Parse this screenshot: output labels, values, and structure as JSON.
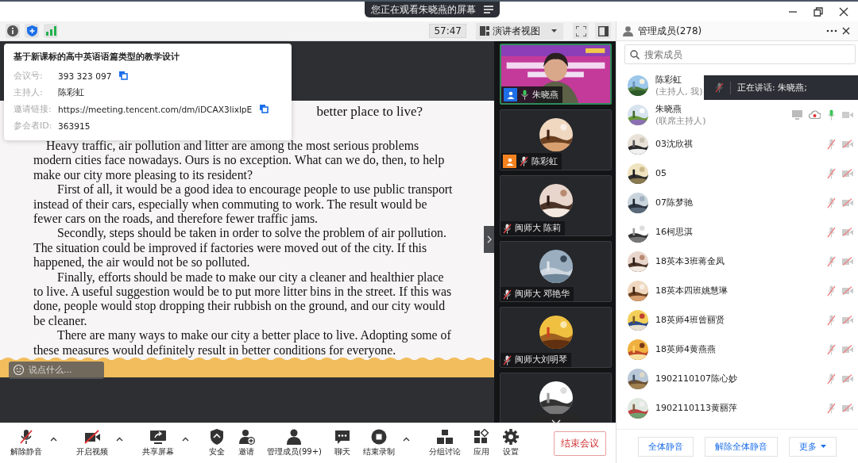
{
  "titlebar": {
    "banner": "您正在观看朱晓燕的屏幕"
  },
  "toolbar": {
    "timer": "57:47",
    "view": "演讲者视图"
  },
  "info_popup": {
    "title": "基于新课标的高中英语语篇类型的教学设计",
    "rows": [
      {
        "label": "会议号:",
        "value": "393 323 097",
        "copyable": true
      },
      {
        "label": "主持人:",
        "value": "陈彩虹",
        "copyable": false
      },
      {
        "label": "邀请链接:",
        "value": "https://meeting.tencent.com/dm/iDCAX3lixlpE",
        "copyable": true
      },
      {
        "label": "参会者ID:",
        "value": "363915",
        "copyable": false
      }
    ]
  },
  "document": {
    "title": "better place to live?",
    "paragraphs": [
      "Heavy traffic, air pollution and litter are among the most serious problems modern cities face nowadays. Ours is no exception. What can we do, then, to help make our city more pleasing to its resident?",
      "First of all, it would be a good idea to encourage people to use public transport instead of their cars, especially when commuting to work. The result would be fewer cars on the roads, and therefore fewer traffic jams.",
      "Secondly, steps should be taken in order to solve the problem of air pollution. The situation could be improved if factories were moved out of the city. If this happened, the air would not be so polluted.",
      "Finally, efforts should be made to make our city a cleaner and healthier place to live. A useful suggestion would be to put more litter bins in the street. If this was done, people would stop dropping their rubbish on the ground, and our city would be cleaner.",
      "There are many ways to make our city a better place to live. Adopting some of these measures would definitely result in better conditions for everyone."
    ]
  },
  "comment_box": {
    "placeholder": "说点什么..."
  },
  "video_tiles": [
    {
      "name": "朱晓燕",
      "kind": "video",
      "selected": true,
      "muted": false,
      "color": "#1d6fe8"
    },
    {
      "name": "陈彩虹",
      "kind": "avatar",
      "selected": false,
      "muted": true,
      "color": "#f5821f"
    },
    {
      "name": "闽师大 陈莉",
      "kind": "avatar",
      "selected": false,
      "muted": true
    },
    {
      "name": "闽师大 邓艳华",
      "kind": "avatar",
      "selected": false,
      "muted": true
    },
    {
      "name": "闽师大刘明琴",
      "kind": "avatar",
      "selected": false,
      "muted": true
    },
    {
      "kind": "avatar",
      "selected": false
    }
  ],
  "members_panel": {
    "title": "管理成员(278)",
    "search": {
      "placeholder": "搜索成员"
    },
    "speaking_toast": "正在讲话: 朱晓燕;",
    "members": [
      {
        "name": "陈彩虹",
        "role": "(主持人, 我)"
      },
      {
        "name": "朱晓燕",
        "role": "(联席主持人)",
        "muted": false,
        "camera_on": true,
        "sharing": true,
        "recording": true
      },
      {
        "name": "03沈欣祺",
        "muted": true,
        "camera_on": false,
        "sharing": false,
        "recording": false
      },
      {
        "name": "05",
        "muted": true,
        "camera_on": false,
        "sharing": false,
        "recording": false
      },
      {
        "name": "07陈梦驰",
        "muted": true,
        "camera_on": false,
        "sharing": false,
        "recording": false
      },
      {
        "name": "16柯思淇",
        "muted": true,
        "camera_on": false,
        "sharing": false,
        "recording": false
      },
      {
        "name": "18英本3班蒋金凤",
        "muted": true,
        "camera_on": false,
        "sharing": false,
        "recording": false
      },
      {
        "name": "18英本四班姚慧琳",
        "muted": true,
        "camera_on": false,
        "sharing": false,
        "recording": false
      },
      {
        "name": "18英师4班曾丽贤",
        "muted": true,
        "camera_on": false,
        "sharing": false,
        "recording": false
      },
      {
        "name": "18英师4黄燕燕",
        "muted": true,
        "camera_on": false,
        "sharing": false,
        "recording": false
      },
      {
        "name": "1902110107陈心妙",
        "muted": true,
        "camera_on": false,
        "sharing": false,
        "recording": false
      },
      {
        "name": "1902110113黄丽萍",
        "muted": true,
        "camera_on": false,
        "sharing": false,
        "recording": false
      }
    ],
    "buttons": [
      {
        "label": "全体静音",
        "dropdown": false
      },
      {
        "label": "解除全体静音",
        "dropdown": false
      },
      {
        "label": "更多",
        "dropdown": true
      }
    ]
  },
  "bottom_toolbar": {
    "items": [
      {
        "label": "解除静音",
        "kind": "mic",
        "dropdown": true
      },
      {
        "label": "开启视频",
        "kind": "video",
        "dropdown": true
      },
      {
        "label": "共享屏幕",
        "kind": "share",
        "dropdown": true
      },
      {
        "label": "安全",
        "kind": "security",
        "dropdown": false
      },
      {
        "label": "邀请",
        "kind": "invite",
        "dropdown": false
      },
      {
        "label": "管理成员(99+)",
        "kind": "members",
        "dropdown": false
      },
      {
        "label": "聊天",
        "kind": "chat",
        "dropdown": false
      },
      {
        "label": "结束录制",
        "kind": "record",
        "dropdown": true
      },
      {
        "label": "分组讨论",
        "kind": "breakout",
        "dropdown": false
      },
      {
        "label": "应用",
        "kind": "apps",
        "dropdown": false
      },
      {
        "label": "设置",
        "kind": "settings",
        "dropdown": false
      }
    ],
    "end_button": "结束会议"
  }
}
